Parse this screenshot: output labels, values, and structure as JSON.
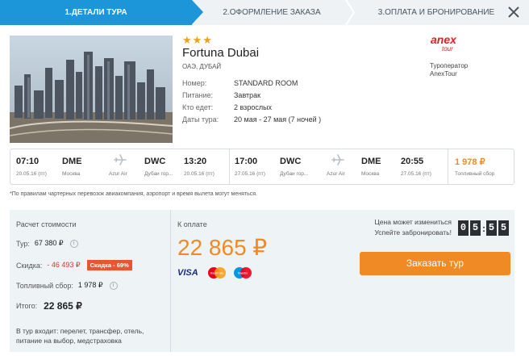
{
  "steps": {
    "step1": "1.Детали тура",
    "step2": "2.Оформление заказа",
    "step3": "3.Оплата и бронирование"
  },
  "hotel": {
    "stars": "★★★",
    "name": "Fortuna Dubai",
    "location": "ОАЭ, ДУБАЙ",
    "rows": [
      {
        "label": "Номер:",
        "value": "STANDARD ROOM"
      },
      {
        "label": "Питание:",
        "value": "Завтрак"
      },
      {
        "label": "Кто едет:",
        "value": "2 взрослых"
      },
      {
        "label": "Даты тура:",
        "value": "20 мая - 27 мая (7 ночей )"
      }
    ]
  },
  "operator": {
    "logo_text": "anex",
    "logo_sub": "tour",
    "label": "Туроператор",
    "name": "AnexTour"
  },
  "flights": {
    "outbound": {
      "dep_time": "07:10",
      "dep_date": "20.05.16 (пт)",
      "dep_code": "DME",
      "dep_city": "Москва",
      "airline": "Azur Air",
      "arr_code": "DWC",
      "arr_city": "Дубаи гор...",
      "arr_time": "13:20",
      "arr_date": "20.05.16 (пт)"
    },
    "return": {
      "dep_time": "17:00",
      "dep_date": "27.05.16 (пт)",
      "dep_code": "DWC",
      "dep_city": "Дубаи гор...",
      "airline": "Azur Air",
      "arr_code": "DME",
      "arr_city": "Москва",
      "arr_time": "20:55",
      "arr_date": "27.05.16 (пт)"
    },
    "fuel_price": "1 978 ₽",
    "fuel_label": "Топливный сбор"
  },
  "note": "*По правилам чартерных перевозок авиакомпания, аэропорт и время вылета могут меняться.",
  "pricing": {
    "title": "Расчет стоимости",
    "tour_label": "Тур:",
    "tour_value": "67 380 ₽",
    "discount_label": "Скидка:",
    "discount_value": "- 46 493 ₽",
    "discount_badge": "Скидка - 69%",
    "fuel_label": "Топливный сбор:",
    "fuel_value": "1 978 ₽",
    "total_label": "Итого:",
    "total_value": "22 865 ₽",
    "includes": "В тур входит: перелет, трансфер, отель, питание на выбор, медстраховка",
    "pay_label": "К оплате",
    "pay_amount": "22 865 ₽",
    "cards": [
      "VISA",
      "MasterCard",
      "Maestro"
    ]
  },
  "booking": {
    "price_change": "Цена может измениться Успейте забронировать!",
    "timer": [
      "0",
      "5",
      "5",
      "5"
    ],
    "button": "Заказать тур"
  },
  "colors": {
    "accent": "#1c96d8",
    "orange": "#f08a24",
    "discount": "#e8552f"
  }
}
